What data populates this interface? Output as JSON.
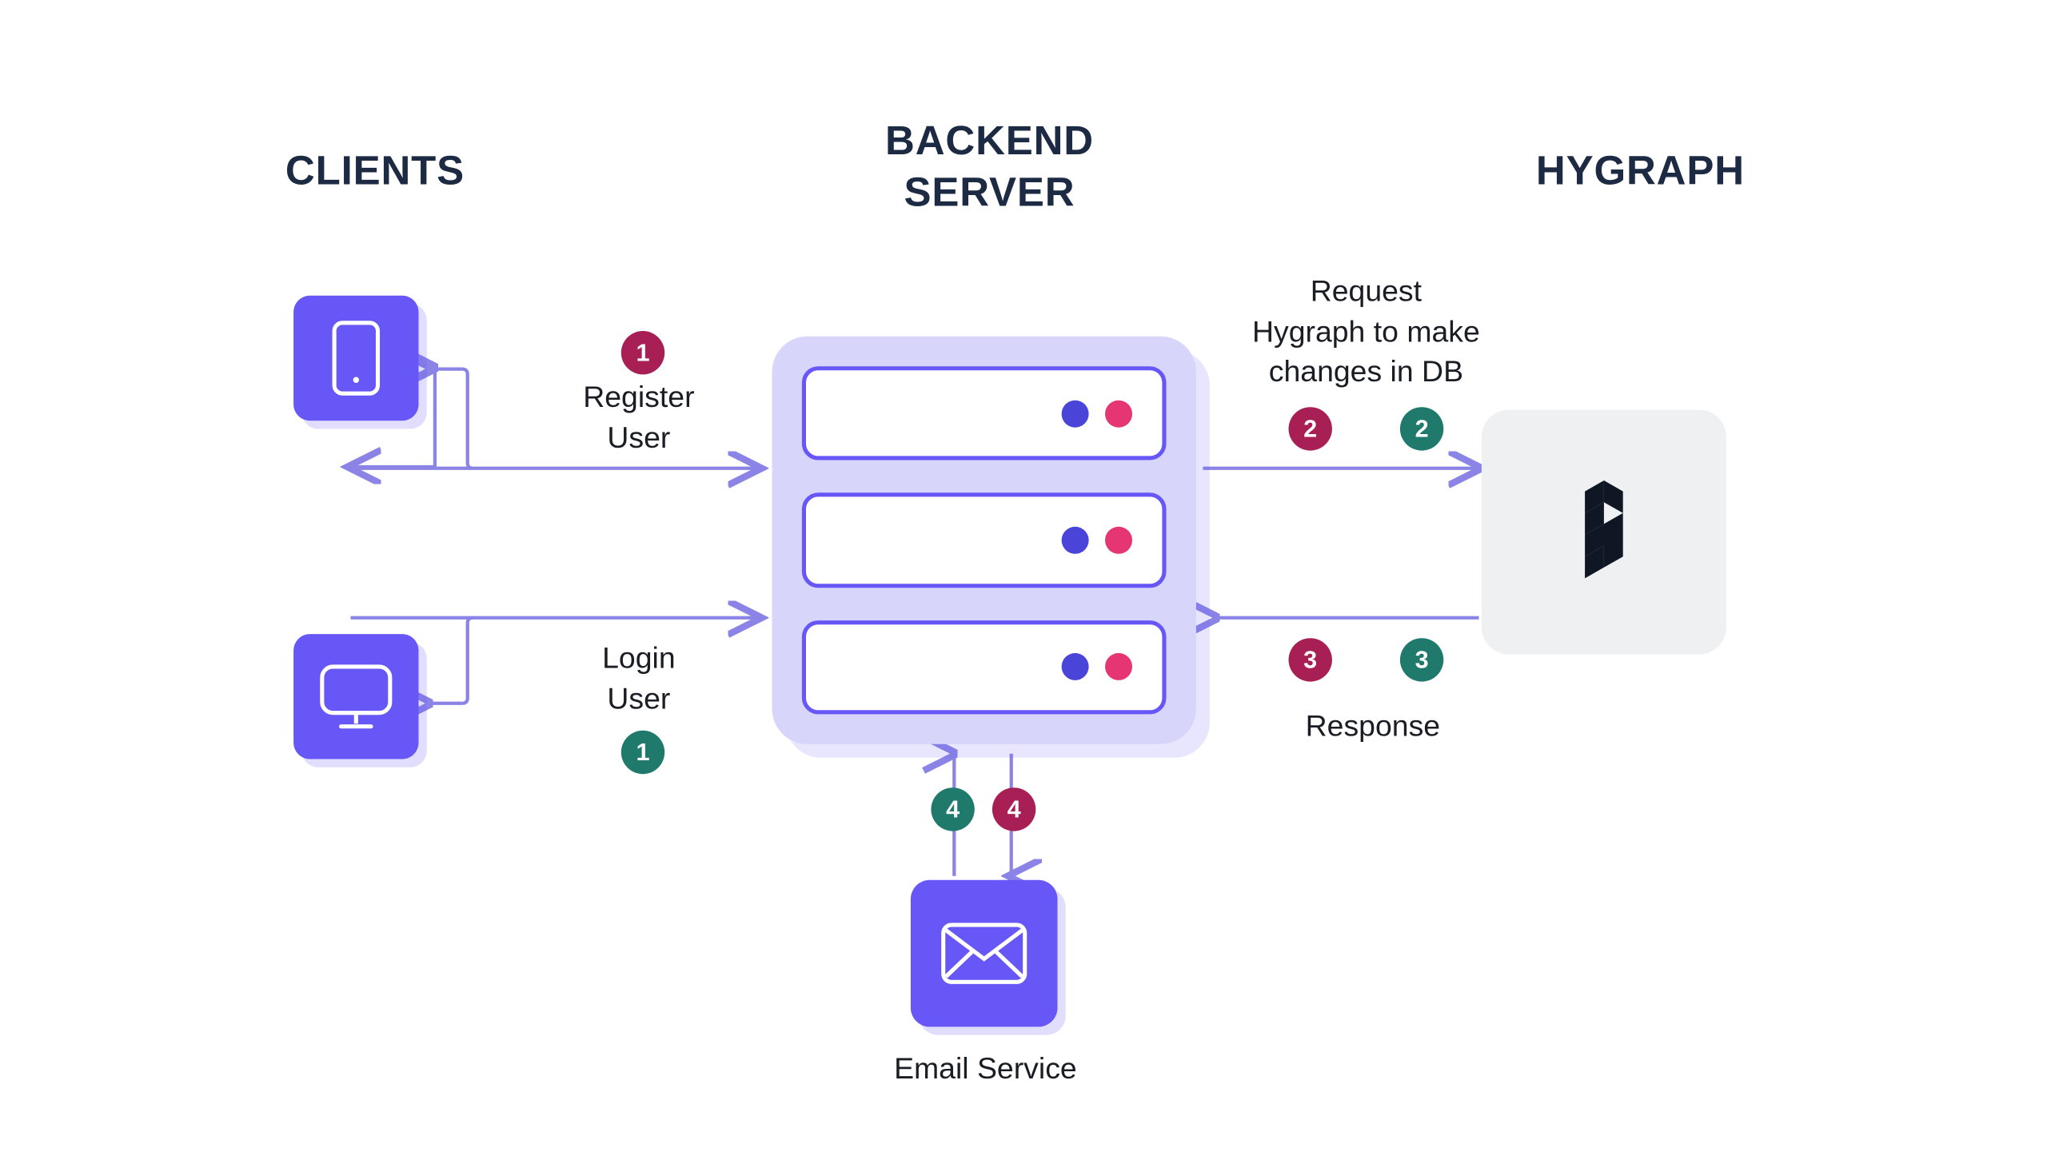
{
  "headings": {
    "clients": "CLIENTS",
    "backend": "BACKEND\nSERVER",
    "hygraph": "HYGRAPH"
  },
  "labels": {
    "register": "Register\nUser",
    "login": "Login\nUser",
    "request": "Request\nHygraph to make\nchanges in DB",
    "response": "Response",
    "email": "Email Service"
  },
  "badges": {
    "one": "1",
    "two": "2",
    "three": "3",
    "four": "4"
  },
  "colors": {
    "primary": "#6657f6",
    "badgePink": "#a71f54",
    "badgeTeal": "#1f7a6c",
    "heading": "#1d2a44",
    "text": "#1a1d24"
  }
}
